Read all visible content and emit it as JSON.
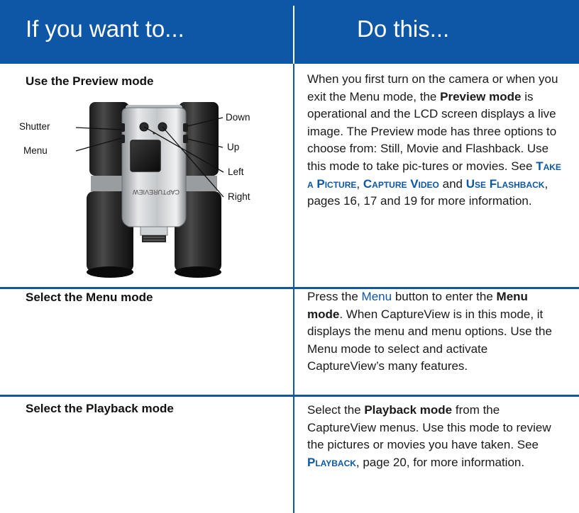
{
  "header": {
    "col1_title": "If you want to...",
    "col2_title": "Do this..."
  },
  "colors": {
    "accent": "#0d57a6",
    "text": "#1a1a1a",
    "background": "#ffffff"
  },
  "rows": [
    {
      "label": "Use the Preview mode",
      "p1": "When you first turn on the camera or when you exit the Menu mode, the",
      "b1": "Preview mode",
      "p2": "is operational and the LCD screen displays a live image. The Preview mode has three options to choose from: Still, Movie and Flashback. Use this mode to take pic-tures or movies. See",
      "link1": "Take a Picture",
      "comma1": ",",
      "link2": "Capture Video",
      "and": "and",
      "link3": "Use Flashback",
      "p3": ", pages 16, 17 and 19 for more information."
    },
    {
      "label": "Select the Menu mode",
      "p1": "Press the",
      "menu_word": "Menu",
      "p2": "button to enter the",
      "b1": "Menu mode",
      "p3": ". When CaptureView is in this mode, it displays the menu and menu options. Use the Menu mode to select and activate CaptureView’s many features."
    },
    {
      "label": "Select the Playback mode",
      "p1": "Select the",
      "b1": "Playback mode",
      "p2": "from the CaptureView menus. Use this mode to review the pictures or movies you have taken. See",
      "link1": "Playback",
      "p3": ", page 20, for more information."
    }
  ],
  "camera_figure": {
    "callouts": {
      "shutter": "Shutter",
      "menu": "Menu",
      "down": "Down",
      "up": "Up",
      "left": "Left",
      "right": "Right"
    },
    "brand_text": "CAPTUREVIEW"
  }
}
